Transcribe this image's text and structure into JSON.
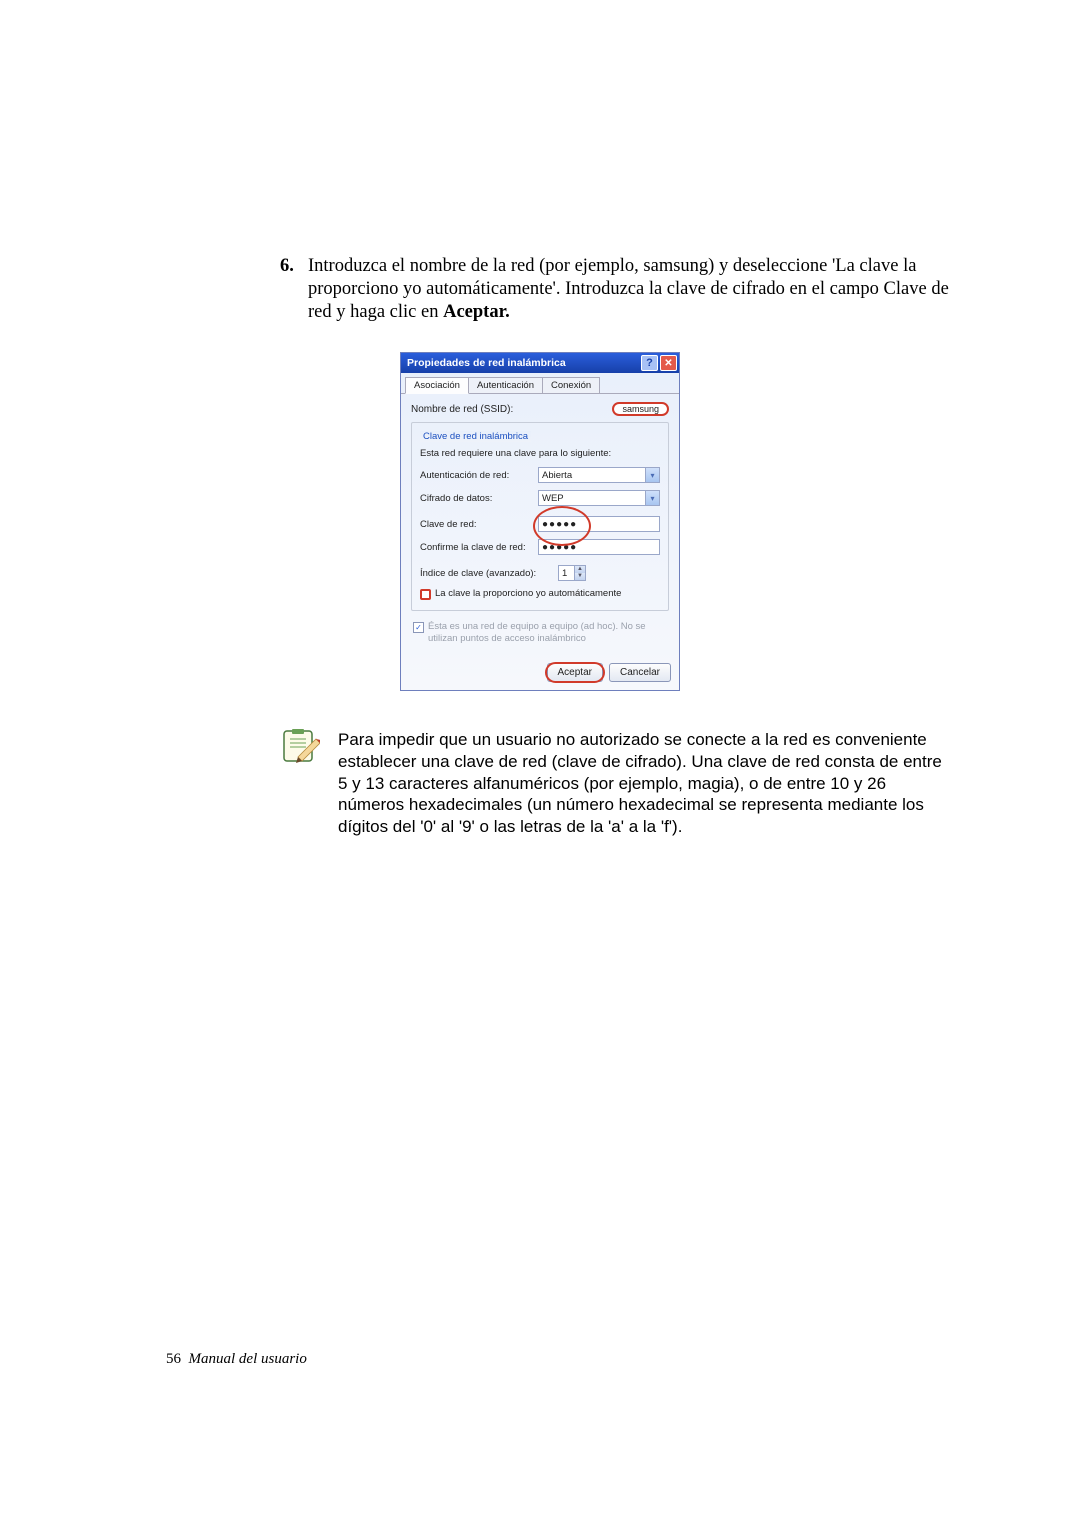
{
  "step": {
    "number": "6.",
    "text_a": "Introduzca el nombre de la red (por ejemplo, samsung) y deseleccione 'La clave la proporciono yo automáticamente'. Introduzca la clave de cifrado en el campo Clave de red y haga clic en ",
    "text_b_bold": "Aceptar."
  },
  "dialog": {
    "title": "Propiedades de red inalámbrica",
    "tabs": {
      "t1": "Asociación",
      "t2": "Autenticación",
      "t3": "Conexión"
    },
    "ssid_label": "Nombre de red (SSID):",
    "ssid_value": "samsung",
    "fieldset_legend": "Clave de red inalámbrica",
    "fieldset_text": "Esta red requiere una clave para lo siguiente:",
    "auth_label": "Autenticación de red:",
    "auth_value": "Abierta",
    "cipher_label": "Cifrado de datos:",
    "cipher_value": "WEP",
    "key_label": "Clave de red:",
    "key_value": "●●●●●",
    "confirm_label": "Confirme la clave de red:",
    "confirm_value": "●●●●●",
    "index_label": "Índice de clave (avanzado):",
    "index_value": "1",
    "autokey_label": "La clave la proporciono yo automáticamente",
    "adhoc_label": "Ésta es una red de equipo a equipo (ad hoc). No se utilizan puntos de acceso inalámbrico",
    "ok": "Aceptar",
    "cancel": "Cancelar"
  },
  "note": {
    "text": "Para impedir que un usuario no autorizado se conecte a la red es conveniente establecer una clave de red (clave de cifrado). Una clave de red consta de entre 5 y 13 caracteres alfanuméricos (por ejemplo, magia), o de entre 10 y 26 números hexadecimales (un número hexadecimal se representa mediante los dígitos del '0' al '9' o las letras de la 'a' a la 'f')."
  },
  "footer": {
    "page_num": "56",
    "label": "Manual del usuario"
  }
}
